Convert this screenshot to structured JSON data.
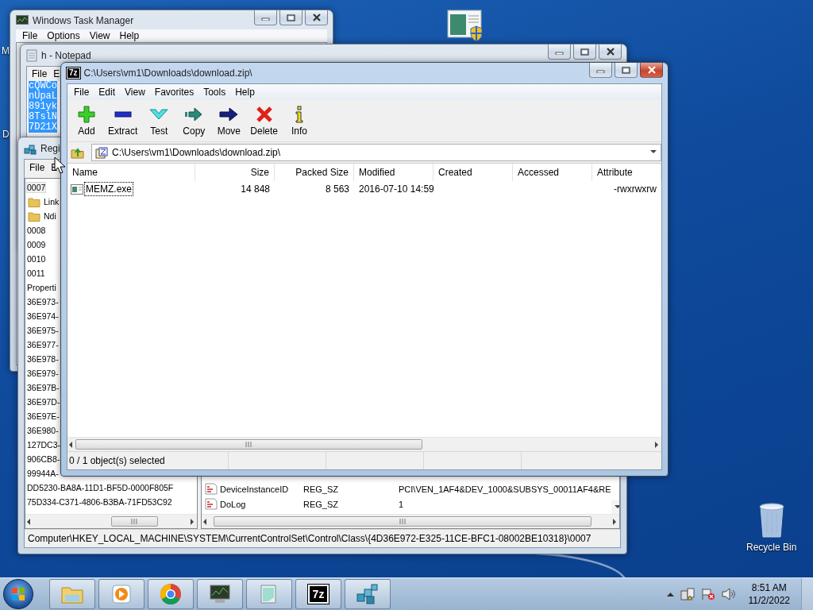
{
  "desktop": {
    "icon_labels": [
      {
        "label": "M"
      },
      {
        "label": "D"
      }
    ],
    "recycle_bin": {
      "label": "Recycle Bin"
    }
  },
  "task_manager": {
    "title": "Windows Task Manager",
    "menu": [
      "File",
      "Options",
      "View",
      "Help"
    ]
  },
  "notepad": {
    "title": "h - Notepad",
    "menu": [
      "File",
      "E"
    ],
    "lines": [
      "cQWCo",
      "nUpaL",
      "891yk",
      "8TslN",
      "7D21X"
    ]
  },
  "registry": {
    "title": "Regi",
    "menu": [
      "File",
      "E"
    ],
    "tree": [
      {
        "label": "0007",
        "selected": true,
        "children": [
          {
            "label": "Link",
            "selected": false
          },
          {
            "label": "Ndi",
            "selected": false
          }
        ]
      },
      {
        "label": "0008",
        "selected": false
      },
      {
        "label": "0009",
        "selected": false
      },
      {
        "label": "0010",
        "selected": false
      },
      {
        "label": "0011",
        "selected": false
      },
      {
        "label": "Properti",
        "selected": false
      },
      {
        "label": "36E973-",
        "selected": false
      },
      {
        "label": "36E974-",
        "selected": false
      },
      {
        "label": "36E975-",
        "selected": false
      },
      {
        "label": "36E977-",
        "selected": false
      },
      {
        "label": "36E978-",
        "selected": false
      },
      {
        "label": "36E979-",
        "selected": false
      },
      {
        "label": "36E97B-",
        "selected": false
      },
      {
        "label": "36E97D-",
        "selected": false
      },
      {
        "label": "36E97E-",
        "selected": false
      },
      {
        "label": "36E980-",
        "selected": false
      },
      {
        "label": "127DC3-",
        "selected": false
      },
      {
        "label": "906CB8-",
        "selected": false
      },
      {
        "label": "99944A-",
        "selected": false
      },
      {
        "label": "DD5230-BA8A-11D1-BF5D-0000F805F",
        "selected": false
      },
      {
        "label": "75D334-C371-4806-B3BA-71FD53C92",
        "selected": false
      }
    ],
    "values": [
      {
        "name": "DeviceInstanceID",
        "type": "REG_SZ",
        "data": "PCI\\VEN_1AF4&DEV_1000&SUBSYS_00011AF4&RE"
      },
      {
        "name": "DoLog",
        "type": "REG_SZ",
        "data": "1"
      }
    ],
    "status": "Computer\\HKEY_LOCAL_MACHINE\\SYSTEM\\CurrentControlSet\\Control\\Class\\{4D36E972-E325-11CE-BFC1-08002BE10318}\\0007"
  },
  "archive_window": {
    "icon_text": "7z",
    "title": "C:\\Users\\vm1\\Downloads\\download.zip\\",
    "menu": [
      "File",
      "Edit",
      "View",
      "Favorites",
      "Tools",
      "Help"
    ],
    "toolbar": [
      {
        "kind": "add",
        "label": "Add"
      },
      {
        "kind": "extract",
        "label": "Extract"
      },
      {
        "kind": "test",
        "label": "Test"
      },
      {
        "kind": "copy",
        "label": "Copy"
      },
      {
        "kind": "move",
        "label": "Move"
      },
      {
        "kind": "delete",
        "label": "Delete"
      },
      {
        "kind": "info",
        "label": "Info"
      }
    ],
    "address": "C:\\Users\\vm1\\Downloads\\download.zip\\",
    "columns": [
      "Name",
      "Size",
      "Packed Size",
      "Modified",
      "Created",
      "Accessed",
      "Attribute"
    ],
    "rows": [
      {
        "name": "MEMZ.exe",
        "size": "14 848",
        "packed_size": "8 563",
        "modified": "2016-07-10 14:59",
        "attributes": "-rwxrwxrw",
        "selected": false,
        "focused": true
      }
    ],
    "status": "0 / 1 object(s) selected"
  },
  "taskbar": {
    "apps": [
      {
        "kind": "explorer"
      },
      {
        "kind": "media"
      },
      {
        "kind": "browser"
      },
      {
        "kind": "taskmgr"
      },
      {
        "kind": "notepad"
      },
      {
        "kind": "archiver",
        "icon_text": "7z"
      },
      {
        "kind": "regedit"
      }
    ],
    "time": "8:51 AM",
    "date": "11/2/2022"
  }
}
